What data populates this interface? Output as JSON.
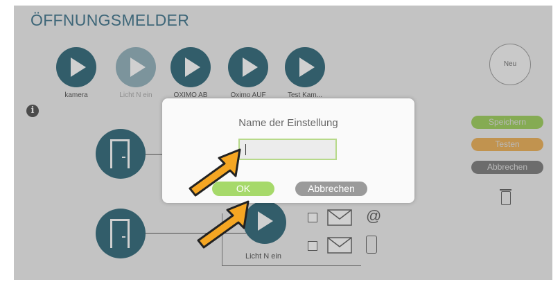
{
  "app": {
    "title": "ÖFFNUNGSMELDER"
  },
  "actions": [
    {
      "label": "kamera",
      "dimmed": false
    },
    {
      "label": "Licht N ein",
      "dimmed": true
    },
    {
      "label": "OXIMO AB",
      "dimmed": false
    },
    {
      "label": "Oximo AUF",
      "dimmed": false
    },
    {
      "label": "Test Kam...",
      "dimmed": false
    }
  ],
  "new_button": {
    "label": "Neu"
  },
  "side_buttons": {
    "save": {
      "label": "Speichern",
      "color": "#8dc63f"
    },
    "test": {
      "label": "Testen",
      "color": "#e8a23a"
    },
    "cancel": {
      "label": "Abbrechen",
      "color": "#777777"
    }
  },
  "bottom_action": {
    "label": "Licht N ein"
  },
  "modal": {
    "title": "Name der Einstellung",
    "input_value": "",
    "ok_label": "OK",
    "cancel_label": "Abbrechen",
    "ok_color": "#a6d96a",
    "cancel_color": "#9a9a9a"
  },
  "icons": {
    "info": "info-icon",
    "email": "email-icon",
    "at": "at-icon",
    "sms": "sms-icon",
    "phone": "phone-icon",
    "trash": "trash-icon",
    "door": "door-icon",
    "play": "play-icon",
    "pointer": "arrow-pointer-icon"
  },
  "glyphs": {
    "at": "@",
    "info": "i"
  }
}
